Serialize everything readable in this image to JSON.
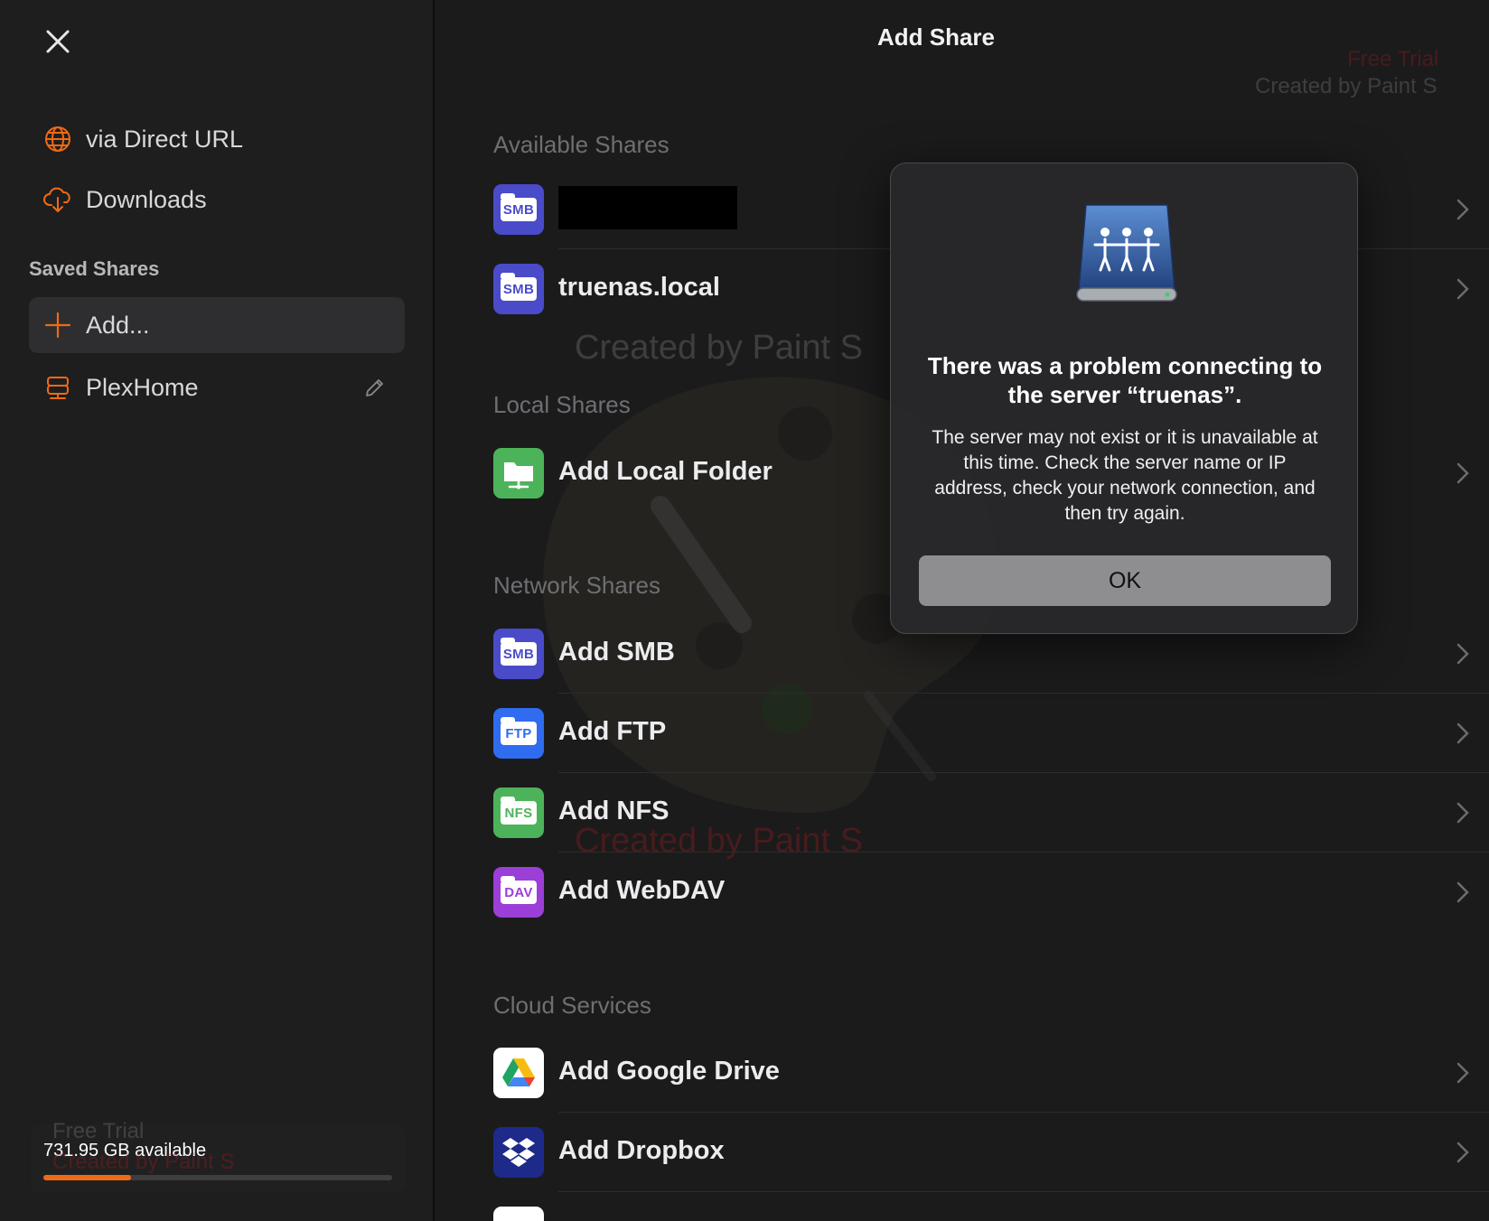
{
  "sidebar": {
    "items": [
      {
        "label": "via Direct URL",
        "icon": "globe-icon"
      },
      {
        "label": "Downloads",
        "icon": "cloud-download-icon"
      }
    ],
    "saved_heading": "Saved Shares",
    "saved_items": [
      {
        "label": "Add...",
        "icon": "plus-icon"
      },
      {
        "label": "PlexHome",
        "icon": "server-icon"
      }
    ],
    "storage": {
      "label": "731.95 GB available",
      "used_fraction": 0.25
    }
  },
  "main": {
    "title": "Add Share",
    "sections": {
      "available": "Available Shares",
      "local": "Local Shares",
      "network": "Network Shares",
      "cloud": "Cloud Services"
    },
    "available_rows": [
      {
        "badge": "SMB",
        "name": "",
        "redacted": true
      },
      {
        "badge": "SMB",
        "name": "truenas.local"
      }
    ],
    "local_rows": [
      {
        "name": "Add Local Folder"
      }
    ],
    "network_rows": [
      {
        "badge": "SMB",
        "name": "Add SMB"
      },
      {
        "badge": "FTP",
        "name": "Add FTP"
      },
      {
        "badge": "NFS",
        "name": "Add NFS"
      },
      {
        "badge": "DAV",
        "name": "Add WebDAV"
      }
    ],
    "cloud_rows": [
      {
        "name": "Add Google Drive"
      },
      {
        "name": "Add Dropbox"
      }
    ]
  },
  "watermarks": {
    "free_trial": "Free Trial",
    "created_by": "Created by Paint S"
  },
  "dialog": {
    "title": "There was a problem connecting to the server “truenas”.",
    "message": "The server may not exist or it is unavailable at this time. Check the server name or IP address, check your network connection, and then try again.",
    "ok_label": "OK"
  },
  "colors": {
    "accent": "#f06a14",
    "smb": "#4a4bc9",
    "ftp": "#2f6cf0",
    "nfs": "#4db35a",
    "dav": "#9b3fd8",
    "local": "#4db35a",
    "dropbox": "#1d2a8a"
  }
}
